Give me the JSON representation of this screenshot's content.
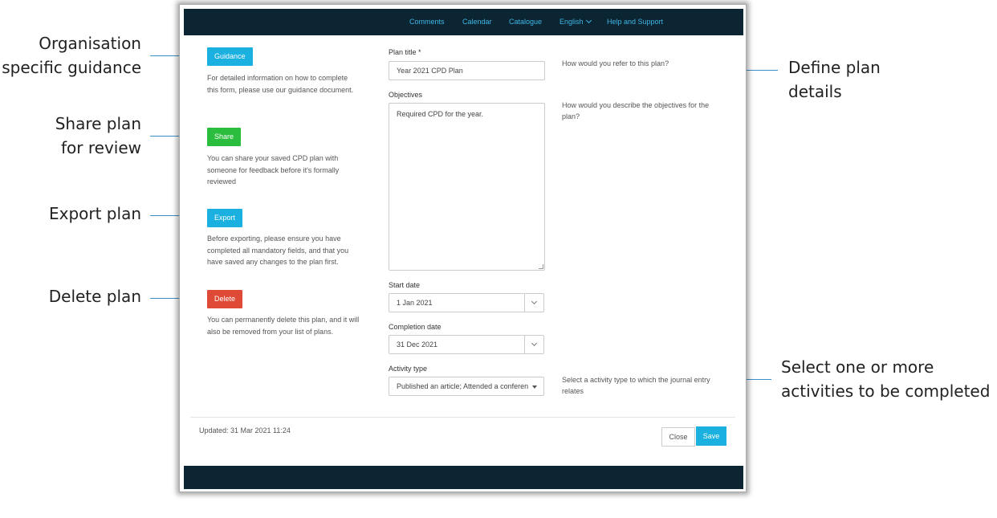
{
  "annotations": {
    "guidance": [
      "Organisation",
      "specific guidance"
    ],
    "share": [
      "Share plan",
      "for review"
    ],
    "export": "Export plan",
    "delete": "Delete plan",
    "define": [
      "Define plan",
      "details"
    ],
    "activities": [
      "Select one or more",
      "activities to be completed"
    ]
  },
  "nav": {
    "comments": "Comments",
    "calendar": "Calendar",
    "catalogue": "Catalogue",
    "language": "English",
    "help": "Help and Support"
  },
  "sidebar": {
    "guidance_label": "Guidance",
    "guidance_desc": "For detailed information on how to complete this form, please use our guidance document.",
    "share_label": "Share",
    "share_desc": "You can share your saved CPD plan with someone for feedback before it's formally reviewed",
    "export_label": "Export",
    "export_desc": "Before exporting, please ensure you have completed all mandatory fields, and that you have saved any changes to the plan first.",
    "delete_label": "Delete",
    "delete_desc": "You can permanently delete this plan, and it will also be removed from your list of plans."
  },
  "form": {
    "title_label": "Plan title *",
    "title_value": "Year 2021 CPD Plan",
    "title_help": "How would you refer to this plan?",
    "objectives_label": "Objectives",
    "objectives_value": "Required CPD for the year.",
    "objectives_help": "How would you describe the objectives for the plan?",
    "start_label": "Start date",
    "start_value": "1 Jan 2021",
    "completion_label": "Completion date",
    "completion_value": "31 Dec 2021",
    "activity_label": "Activity type",
    "activity_value": "Published an article; Attended a conferen",
    "activity_help": "Select a activity type to which the journal entry relates"
  },
  "footer": {
    "updated": "Updated: 31 Mar 2021 11:24",
    "close_label": "Close",
    "save_label": "Save"
  },
  "colors": {
    "navbar": "#0b2533",
    "primary": "#1ab0e0",
    "share": "#2bbd3e",
    "delete": "#de4a36",
    "link": "#3fb6e6"
  }
}
